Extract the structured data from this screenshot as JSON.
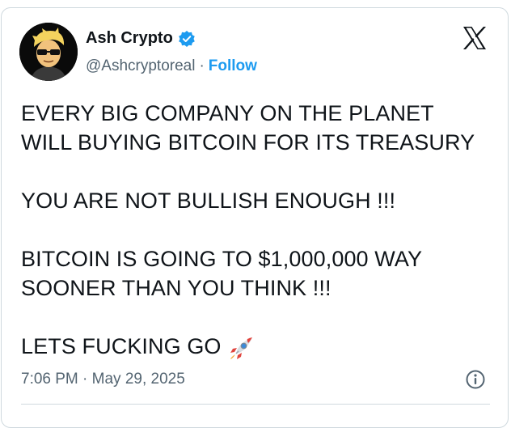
{
  "author": {
    "name": "Ash Crypto",
    "handle": "@Ashcryptoreal",
    "separator": "·",
    "follow_label": "Follow",
    "verified": true,
    "verified_color": "#1d9bf0"
  },
  "tweet": {
    "lines": [
      "EVERY BIG COMPANY ON THE PLANET",
      "WILL BUYING BITCOIN FOR ITS TREASURY",
      "YOU ARE NOT BULLISH ENOUGH !!!",
      "BITCOIN IS GOING TO $1,000,000 WAY",
      "SOONER THAN YOU THINK !!!",
      "LETS FUCKING GO"
    ],
    "emoji": "rocket"
  },
  "footer": {
    "timestamp": "7:06 PM · May 29, 2025"
  },
  "icons": {
    "brand": "x-logo-icon",
    "verified": "verified-badge-icon",
    "info": "info-icon"
  },
  "colors": {
    "text": "#0f1419",
    "secondary": "#536471",
    "accent": "#1d9bf0",
    "border": "#cfd9de"
  }
}
